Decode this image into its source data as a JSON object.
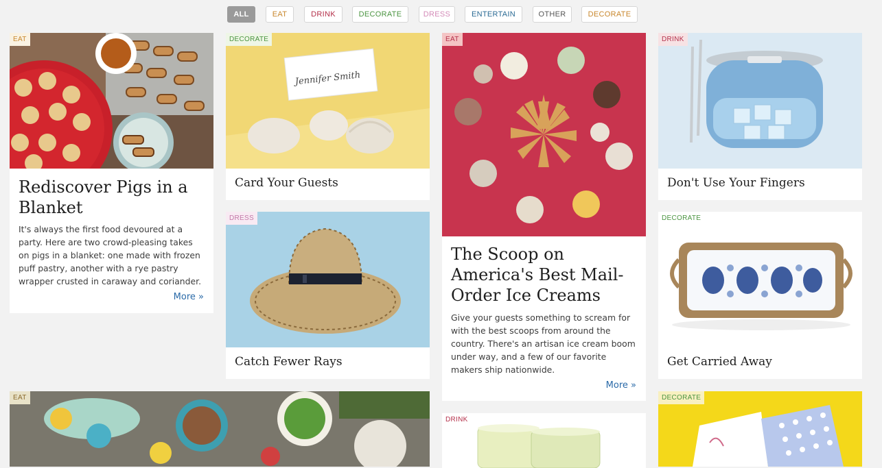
{
  "filters": [
    {
      "label": "ALL",
      "color": "#ffffff"
    },
    {
      "label": "EAT",
      "color": "#c8872c"
    },
    {
      "label": "DRINK",
      "color": "#b4304a"
    },
    {
      "label": "DECORATE",
      "color": "#4a9440"
    },
    {
      "label": "DRESS",
      "color": "#d48bb8"
    },
    {
      "label": "ENTERTAIN",
      "color": "#2a6a94"
    },
    {
      "label": "OTHER",
      "color": "#555555"
    },
    {
      "label": "DECORATE",
      "color": "#c8872c"
    }
  ],
  "cards": {
    "pigs": {
      "tag": "EAT",
      "title": "Rediscover Pigs in a Blanket",
      "description": "It's always the first food devoured at a party. Here are two crowd-pleasing takes on pigs in a blanket: one made with frozen puff pastry, another with a rye pastry wrapper crusted in caraway and coriander.",
      "more": "More »"
    },
    "card_guests": {
      "tag": "DECORATE",
      "title": "Card Your Guests",
      "place_card_text": "Jennifer Smith"
    },
    "scoop": {
      "tag": "EAT",
      "title": "The Scoop on America's Best Mail-Order Ice Creams",
      "description": "Give your guests something to scream for with the best scoops from around the country. There's an artisan ice cream boom under way, and a few of our favorite makers ship nationwide.",
      "more": "More »"
    },
    "fingers": {
      "tag": "DRINK",
      "title": "Don't Use Your Fingers"
    },
    "rays": {
      "tag": "DRESS",
      "title": "Catch Fewer Rays"
    },
    "carried": {
      "tag": "DECORATE",
      "title": "Get Carried Away"
    },
    "picnic": {
      "tag": "EAT"
    },
    "glasses": {
      "tag": "DRINK"
    },
    "napkins": {
      "tag": "DECORATE"
    }
  }
}
